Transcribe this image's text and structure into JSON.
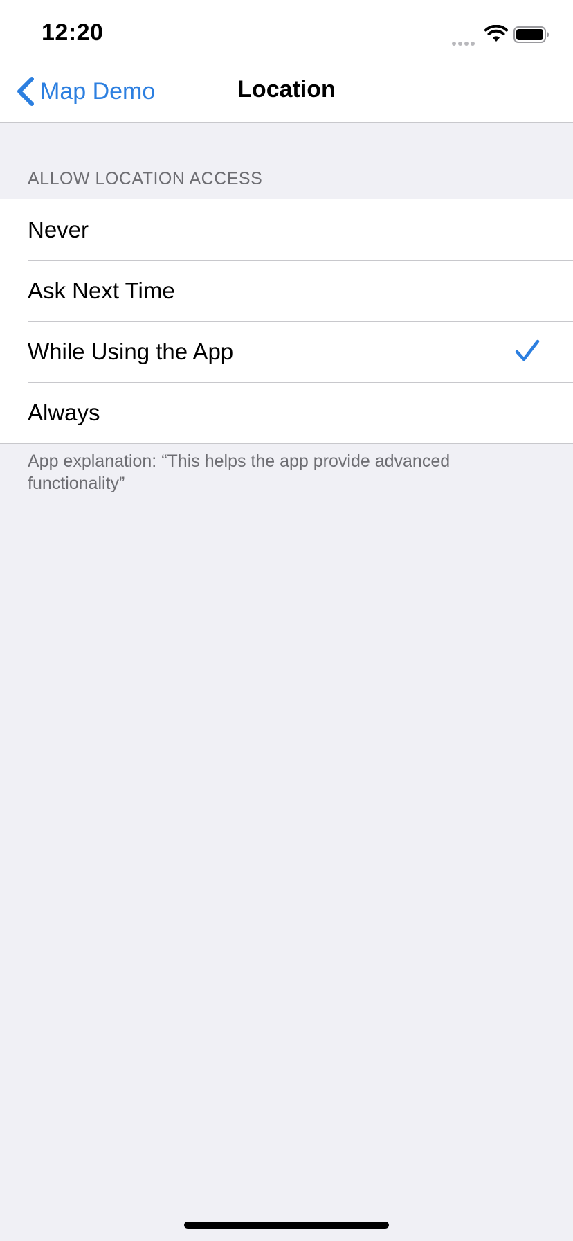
{
  "status_bar": {
    "time": "12:20",
    "icons": [
      "signal-dots-icon",
      "wifi-icon",
      "battery-icon"
    ]
  },
  "nav": {
    "back_label": "Map Demo",
    "title": "Location",
    "back_icon": "chevron-left-icon"
  },
  "section": {
    "header": "ALLOW LOCATION ACCESS",
    "options": [
      {
        "label": "Never",
        "selected": false
      },
      {
        "label": "Ask Next Time",
        "selected": false
      },
      {
        "label": "While Using the App",
        "selected": true
      },
      {
        "label": "Always",
        "selected": false
      }
    ],
    "footer": "App explanation: “This helps the app provide advanced functionality”"
  },
  "colors": {
    "accent": "#2c7fe0",
    "background": "#f0f0f5",
    "secondary_text": "#6d6d72"
  }
}
